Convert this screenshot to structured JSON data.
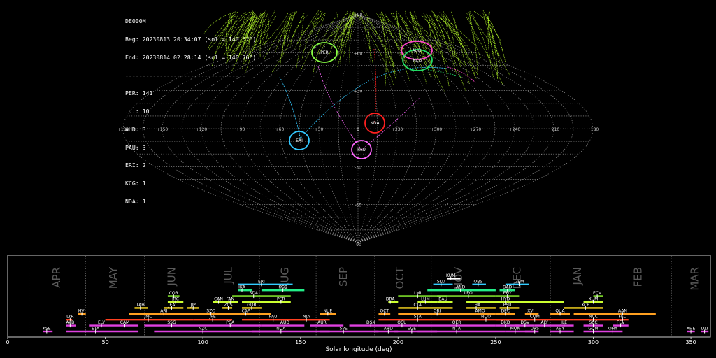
{
  "header": {
    "station": "DE000M",
    "beg": "Beg: 20230813 20:34:07 (sol = 140.52°)",
    "end": "End: 20230814 02:28:14 (sol = 140.76°)",
    "divider": "-----------------------------------",
    "counts": [
      "PER: 141",
      "...: 10",
      "AUD: 3",
      "PAU: 3",
      "ERI: 2",
      "KCG: 1",
      "NDA: 1"
    ]
  },
  "colors": {
    "per": "#b8ff2a",
    "eri": "#33c8ff",
    "nda": "#ff2020",
    "pau": "#ff66ff",
    "aud": "#ff44cc",
    "kcg": "#22dd66",
    "grid": "#aaaaaa"
  },
  "sky_map": {
    "lat_labels": [
      "+90",
      "+60",
      "+30",
      "0",
      "-30",
      "-60",
      "-90"
    ],
    "lon_labels": [
      "+180",
      "+150",
      "+120",
      "+90",
      "+60",
      "+30",
      "0",
      "+330",
      "+300",
      "+270",
      "+240",
      "+210",
      "+180"
    ],
    "radiants": [
      {
        "code": "PER",
        "color": "#88ff44"
      },
      {
        "code": "AUD",
        "color": "#ff44cc"
      },
      {
        "code": "KCG",
        "color": "#22dd66"
      },
      {
        "code": "NDA",
        "color": "#ff2020"
      },
      {
        "code": "ERI",
        "color": "#33c8ff"
      },
      {
        "code": "PAU",
        "color": "#ff66ff"
      }
    ]
  },
  "chart_data": {
    "type": "timeline",
    "xlabel": "Solar longitude (deg)",
    "xlim": [
      0,
      360
    ],
    "xticks": [
      0,
      50,
      100,
      150,
      200,
      250,
      300,
      350
    ],
    "current_sol": 140.6,
    "months": [
      {
        "name": "APR",
        "x": 25
      },
      {
        "name": "MAY",
        "x": 54
      },
      {
        "name": "JUN",
        "x": 84
      },
      {
        "name": "JUL",
        "x": 113
      },
      {
        "name": "AUG",
        "x": 142
      },
      {
        "name": "SEP",
        "x": 172
      },
      {
        "name": "OCT",
        "x": 201
      },
      {
        "name": "NOV",
        "x": 231
      },
      {
        "name": "DEC",
        "x": 261
      },
      {
        "name": "JAN",
        "x": 292
      },
      {
        "name": "FEB",
        "x": 323
      },
      {
        "name": "MAR",
        "x": 352
      }
    ],
    "month_boundaries": [
      11,
      40,
      70,
      99,
      129,
      158,
      188,
      217,
      248,
      278,
      310,
      340
    ],
    "showers": [
      {
        "code": "KSE",
        "start": 18,
        "end": 23,
        "peak": 20,
        "row": 0,
        "color": "#e040e0"
      },
      {
        "code": "ETA",
        "start": 30,
        "end": 67,
        "peak": 45,
        "row": 0,
        "color": "#e040e0"
      },
      {
        "code": "NZC",
        "start": 75,
        "end": 140,
        "peak": 100,
        "row": 0,
        "color": "#e040e0"
      },
      {
        "code": "NDA",
        "start": 125,
        "end": 165,
        "peak": 140,
        "row": 0,
        "color": "#e040e0"
      },
      {
        "code": "SPE",
        "start": 160,
        "end": 190,
        "peak": 172,
        "row": 0,
        "color": "#e040e0"
      },
      {
        "code": "ARD",
        "start": 188,
        "end": 200,
        "peak": 195,
        "row": 0,
        "color": "#e040e0"
      },
      {
        "code": "EGE",
        "start": 198,
        "end": 220,
        "peak": 207,
        "row": 0,
        "color": "#e040e0"
      },
      {
        "code": "NTA",
        "start": 210,
        "end": 255,
        "peak": 230,
        "row": 0,
        "color": "#e040e0"
      },
      {
        "code": "MON",
        "start": 255,
        "end": 270,
        "peak": 260,
        "row": 0,
        "color": "#e040e0"
      },
      {
        "code": "URS",
        "start": 265,
        "end": 272,
        "peak": 270,
        "row": 0,
        "color": "#e040e0"
      },
      {
        "code": "AHY",
        "start": 278,
        "end": 290,
        "peak": 283,
        "row": 0,
        "color": "#e040e0"
      },
      {
        "code": "GUM",
        "start": 295,
        "end": 305,
        "peak": 300,
        "row": 0,
        "color": "#e040e0"
      },
      {
        "code": "OHY",
        "start": 305,
        "end": 315,
        "peak": 310,
        "row": 0,
        "color": "#e040e0"
      },
      {
        "code": "XHE",
        "start": 348,
        "end": 352,
        "peak": 350,
        "row": 0,
        "color": "#e040e0"
      },
      {
        "code": "DLI",
        "start": 355,
        "end": 359,
        "peak": 357,
        "row": 0,
        "color": "#e040e0"
      },
      {
        "code": "AVB",
        "start": 30,
        "end": 35,
        "peak": 32,
        "row": 1,
        "color": "#e040e0"
      },
      {
        "code": "ELY",
        "start": 42,
        "end": 55,
        "peak": 48,
        "row": 1,
        "color": "#e040e0"
      },
      {
        "code": "SSG",
        "start": 70,
        "end": 100,
        "peak": 84,
        "row": 1,
        "color": "#e040e0"
      },
      {
        "code": "PCA",
        "start": 100,
        "end": 130,
        "peak": 114,
        "row": 1,
        "color": "#e040e0"
      },
      {
        "code": "AUD",
        "start": 130,
        "end": 152,
        "peak": 142,
        "row": 1,
        "color": "#e040e0"
      },
      {
        "code": "AUR",
        "start": 155,
        "end": 172,
        "peak": 161,
        "row": 1,
        "color": "#e040e0"
      },
      {
        "code": "DSX",
        "start": 175,
        "end": 200,
        "peak": 186,
        "row": 1,
        "color": "#e040e0"
      },
      {
        "code": "OCU",
        "start": 195,
        "end": 210,
        "peak": 202,
        "row": 1,
        "color": "#e040e0"
      },
      {
        "code": "OER",
        "start": 210,
        "end": 250,
        "peak": 230,
        "row": 1,
        "color": "#e040e0"
      },
      {
        "code": "DKD",
        "start": 250,
        "end": 262,
        "peak": 255,
        "row": 1,
        "color": "#e040e0"
      },
      {
        "code": "DSV",
        "start": 260,
        "end": 270,
        "peak": 265,
        "row": 1,
        "color": "#e040e0"
      },
      {
        "code": "ALY",
        "start": 270,
        "end": 280,
        "peak": 275,
        "row": 1,
        "color": "#e040e0"
      },
      {
        "code": "JLE",
        "start": 280,
        "end": 290,
        "peak": 285,
        "row": 1,
        "color": "#e040e0"
      },
      {
        "code": "SCC",
        "start": 295,
        "end": 305,
        "peak": 300,
        "row": 1,
        "color": "#e040e0"
      },
      {
        "code": "FEV",
        "start": 310,
        "end": 318,
        "peak": 314,
        "row": 1,
        "color": "#e040e0"
      },
      {
        "code": "CAM",
        "start": 55,
        "end": 67,
        "peak": 60,
        "row": 1,
        "color": "#e040e0"
      },
      {
        "code": "LYR",
        "start": 30,
        "end": 33,
        "peak": 32,
        "row": 2,
        "color": "#ff4020"
      },
      {
        "code": "JMC",
        "start": 50,
        "end": 95,
        "peak": 72,
        "row": 2,
        "color": "#ff4020"
      },
      {
        "code": "JPE",
        "start": 95,
        "end": 115,
        "peak": 105,
        "row": 2,
        "color": "#ff4020"
      },
      {
        "code": "PAU",
        "start": 120,
        "end": 160,
        "peak": 136,
        "row": 2,
        "color": "#ff4020"
      },
      {
        "code": "NIA",
        "start": 140,
        "end": 165,
        "peak": 153,
        "row": 2,
        "color": "#ff4020"
      },
      {
        "code": "STA",
        "start": 190,
        "end": 230,
        "peak": 210,
        "row": 2,
        "color": "#ff4020"
      },
      {
        "code": "NOO",
        "start": 230,
        "end": 255,
        "peak": 245,
        "row": 2,
        "color": "#ff4020"
      },
      {
        "code": "COM",
        "start": 250,
        "end": 290,
        "peak": 270,
        "row": 2,
        "color": "#ff4020"
      },
      {
        "code": "NCC",
        "start": 290,
        "end": 310,
        "peak": 300,
        "row": 2,
        "color": "#ff4020"
      },
      {
        "code": "FED",
        "start": 310,
        "end": 318,
        "peak": 315,
        "row": 2,
        "color": "#ff4020"
      },
      {
        "code": "HVI",
        "start": 36,
        "end": 40,
        "peak": 38,
        "row": 3,
        "color": "#ffa020"
      },
      {
        "code": "ARI",
        "start": 62,
        "end": 100,
        "peak": 80,
        "row": 3,
        "color": "#ffa020"
      },
      {
        "code": "SZC",
        "start": 100,
        "end": 108,
        "peak": 104,
        "row": 3,
        "color": "#ffa020"
      },
      {
        "code": "CAP",
        "start": 108,
        "end": 135,
        "peak": 122,
        "row": 3,
        "color": "#ffa020"
      },
      {
        "code": "NUE",
        "start": 160,
        "end": 168,
        "peak": 164,
        "row": 3,
        "color": "#ffa020"
      },
      {
        "code": "OCT",
        "start": 190,
        "end": 196,
        "peak": 193,
        "row": 3,
        "color": "#ffa020"
      },
      {
        "code": "ORI",
        "start": 200,
        "end": 240,
        "peak": 220,
        "row": 3,
        "color": "#ffa020"
      },
      {
        "code": "AMO",
        "start": 235,
        "end": 250,
        "peak": 242,
        "row": 3,
        "color": "#ffa020"
      },
      {
        "code": "DEC",
        "start": 250,
        "end": 260,
        "peak": 255,
        "row": 3,
        "color": "#ffa020"
      },
      {
        "code": "XVI",
        "start": 265,
        "end": 272,
        "peak": 268,
        "row": 3,
        "color": "#ffa020"
      },
      {
        "code": "QUA",
        "start": 278,
        "end": 288,
        "peak": 283,
        "row": 3,
        "color": "#ffa020"
      },
      {
        "code": "AAN",
        "start": 290,
        "end": 332,
        "peak": 315,
        "row": 3,
        "color": "#ffa020"
      },
      {
        "code": "TAH",
        "start": 65,
        "end": 72,
        "peak": 68,
        "row": 4,
        "color": "#ffdd20"
      },
      {
        "code": "JEA",
        "start": 80,
        "end": 90,
        "peak": 84,
        "row": 4,
        "color": "#ffdd20"
      },
      {
        "code": "JIP",
        "start": 92,
        "end": 98,
        "peak": 95,
        "row": 4,
        "color": "#ffdd20"
      },
      {
        "code": "ZCS",
        "start": 110,
        "end": 115,
        "peak": 113,
        "row": 4,
        "color": "#ffdd20"
      },
      {
        "code": "GDR",
        "start": 120,
        "end": 130,
        "peak": 125,
        "row": 4,
        "color": "#ffdd20"
      },
      {
        "code": "CTA",
        "start": 200,
        "end": 228,
        "peak": 210,
        "row": 4,
        "color": "#ffdd20"
      },
      {
        "code": "THA",
        "start": 235,
        "end": 250,
        "peak": 240,
        "row": 4,
        "color": "#ffdd20"
      },
      {
        "code": "PSU",
        "start": 252,
        "end": 262,
        "peak": 256,
        "row": 4,
        "color": "#ffdd20"
      },
      {
        "code": "XCB",
        "start": 285,
        "end": 305,
        "peak": 296,
        "row": 4,
        "color": "#ffdd20"
      },
      {
        "code": "JRC",
        "start": 82,
        "end": 90,
        "peak": 86,
        "row": 5,
        "color": "#ccff30"
      },
      {
        "code": "CAN",
        "start": 105,
        "end": 112,
        "peak": 108,
        "row": 5,
        "color": "#ccff30"
      },
      {
        "code": "FAN",
        "start": 111,
        "end": 118,
        "peak": 114,
        "row": 5,
        "color": "#ccff30"
      },
      {
        "code": "PER",
        "start": 120,
        "end": 145,
        "peak": 140,
        "row": 5,
        "color": "#ccff30"
      },
      {
        "code": "DRA",
        "start": 195,
        "end": 200,
        "peak": 196,
        "row": 5,
        "color": "#ccff30"
      },
      {
        "code": "LUM",
        "start": 210,
        "end": 220,
        "peak": 214,
        "row": 5,
        "color": "#ccff30"
      },
      {
        "code": "BAU",
        "start": 220,
        "end": 228,
        "peak": 223,
        "row": 5,
        "color": "#ccff30"
      },
      {
        "code": "HYD",
        "start": 235,
        "end": 285,
        "peak": 255,
        "row": 5,
        "color": "#ccff30"
      },
      {
        "code": "XUM",
        "start": 295,
        "end": 305,
        "peak": 300,
        "row": 5,
        "color": "#ccff30"
      },
      {
        "code": "COR",
        "start": 82,
        "end": 88,
        "peak": 85,
        "row": 6,
        "color": "#90ff30"
      },
      {
        "code": "SDA",
        "start": 115,
        "end": 145,
        "peak": 126,
        "row": 6,
        "color": "#90ff30"
      },
      {
        "code": "LMI",
        "start": 200,
        "end": 225,
        "peak": 210,
        "row": 6,
        "color": "#90ff30"
      },
      {
        "code": "LEO",
        "start": 220,
        "end": 250,
        "peak": 236,
        "row": 6,
        "color": "#90ff30"
      },
      {
        "code": "EHY",
        "start": 250,
        "end": 262,
        "peak": 256,
        "row": 6,
        "color": "#90ff30"
      },
      {
        "code": "ECV",
        "start": 300,
        "end": 305,
        "peak": 302,
        "row": 6,
        "color": "#90ff30"
      },
      {
        "code": "IKA",
        "start": 118,
        "end": 125,
        "peak": 120,
        "row": 7,
        "color": "#22ee88"
      },
      {
        "code": "KCG",
        "start": 130,
        "end": 152,
        "peak": 141,
        "row": 7,
        "color": "#22ee88"
      },
      {
        "code": "AND",
        "start": 215,
        "end": 250,
        "peak": 232,
        "row": 7,
        "color": "#22ee88"
      },
      {
        "code": "DAD",
        "start": 252,
        "end": 260,
        "peak": 256,
        "row": 7,
        "color": "#22ee88"
      },
      {
        "code": "ERI",
        "start": 118,
        "end": 146,
        "peak": 130,
        "row": 8,
        "color": "#33ccff"
      },
      {
        "code": "SLD",
        "start": 218,
        "end": 228,
        "peak": 222,
        "row": 8,
        "color": "#33ccff"
      },
      {
        "code": "OBS",
        "start": 238,
        "end": 245,
        "peak": 241,
        "row": 8,
        "color": "#33ccff"
      },
      {
        "code": "GEM",
        "start": 255,
        "end": 267,
        "peak": 262,
        "row": 8,
        "color": "#33ccff"
      },
      {
        "code": "KUM",
        "start": 225,
        "end": 232,
        "peak": 227,
        "row": 9,
        "color": "#ffffff"
      }
    ]
  }
}
